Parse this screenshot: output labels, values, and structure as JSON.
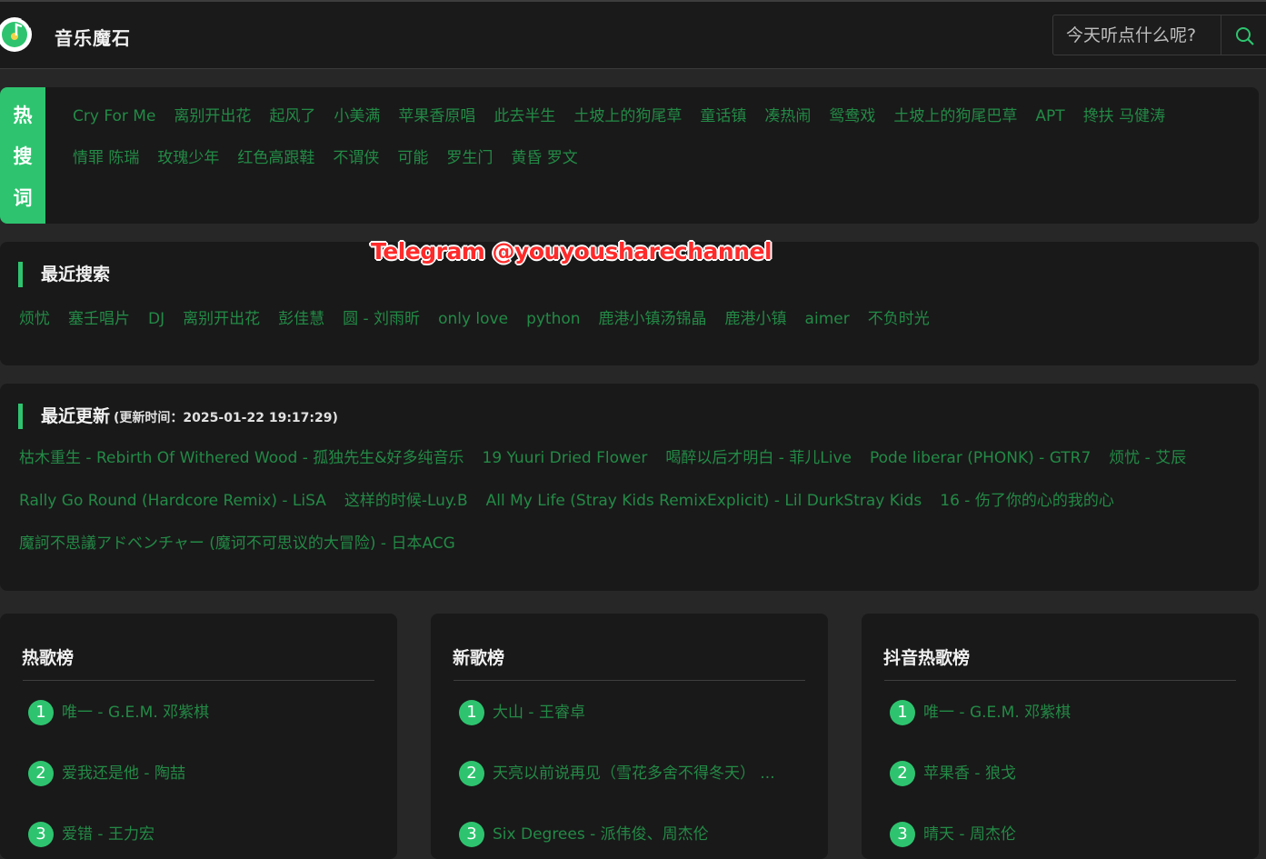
{
  "header": {
    "site_title": "音乐魔石",
    "search_placeholder": "今天听点什么呢?"
  },
  "hot_search": {
    "tab_chars": [
      "热",
      "搜",
      "词"
    ],
    "words": [
      "Cry For Me",
      "离别开出花",
      "起风了",
      "小美满",
      "苹果香原唱",
      "此去半生",
      "土坡上的狗尾草",
      "童话镇",
      "凑热闹",
      "鸳鸯戏",
      "土坡上的狗尾巴草",
      "APT",
      "搀扶 马健涛",
      "情罪 陈瑞",
      "玫瑰少年",
      "红色高跟鞋",
      "不谓侠",
      "可能",
      "罗生门",
      "黄昏 罗文"
    ]
  },
  "recent_search": {
    "title": "最近搜索",
    "words": [
      "烦忧",
      "塞壬唱片",
      "DJ",
      "离别开出花",
      "彭佳慧",
      "圆 - 刘雨昕",
      "only love",
      "python",
      "鹿港小镇汤锦晶",
      "鹿港小镇",
      "aimer",
      "不负时光"
    ]
  },
  "recent_update": {
    "title": "最近更新",
    "time_note": "(更新时间：2025-01-22 19:17:29)",
    "items": [
      "枯木重生 - Rebirth Of Withered Wood - 孤独先生&好多纯音乐",
      "19 Yuuri Dried Flower",
      "喝醉以后才明白 - 菲儿Live",
      "Pode liberar (PHONK) - GTR7",
      "烦忧 - 艾辰",
      "Rally Go Round (Hardcore Remix) - LiSA",
      "这样的时候-Luy.B",
      "All My Life (Stray Kids RemixExplicit) - Lil DurkStray Kids",
      "16 - 伤了你的心的我的心",
      "魔訶不思議アドベンチャー (魔诃不可思议的大冒险) - 日本ACG"
    ]
  },
  "watermark": "Telegram @youyousharechannel",
  "charts": [
    {
      "title": "热歌榜",
      "items": [
        {
          "rank": "1",
          "text": "唯一 - G.E.M. 邓紫棋"
        },
        {
          "rank": "2",
          "text": "爱我还是他 - 陶喆"
        },
        {
          "rank": "3",
          "text": "爱错 - 王力宏"
        }
      ]
    },
    {
      "title": "新歌榜",
      "items": [
        {
          "rank": "1",
          "text": "大山 - 王睿卓"
        },
        {
          "rank": "2",
          "text": "天亮以前说再见（雪花多舍不得冬天） ..."
        },
        {
          "rank": "3",
          "text": "Six Degrees - 派伟俊、周杰伦"
        }
      ]
    },
    {
      "title": "抖音热歌榜",
      "items": [
        {
          "rank": "1",
          "text": "唯一 - G.E.M. 邓紫棋"
        },
        {
          "rank": "2",
          "text": "苹果香 - 狼戈"
        },
        {
          "rank": "3",
          "text": "晴天 - 周杰伦"
        }
      ]
    }
  ]
}
